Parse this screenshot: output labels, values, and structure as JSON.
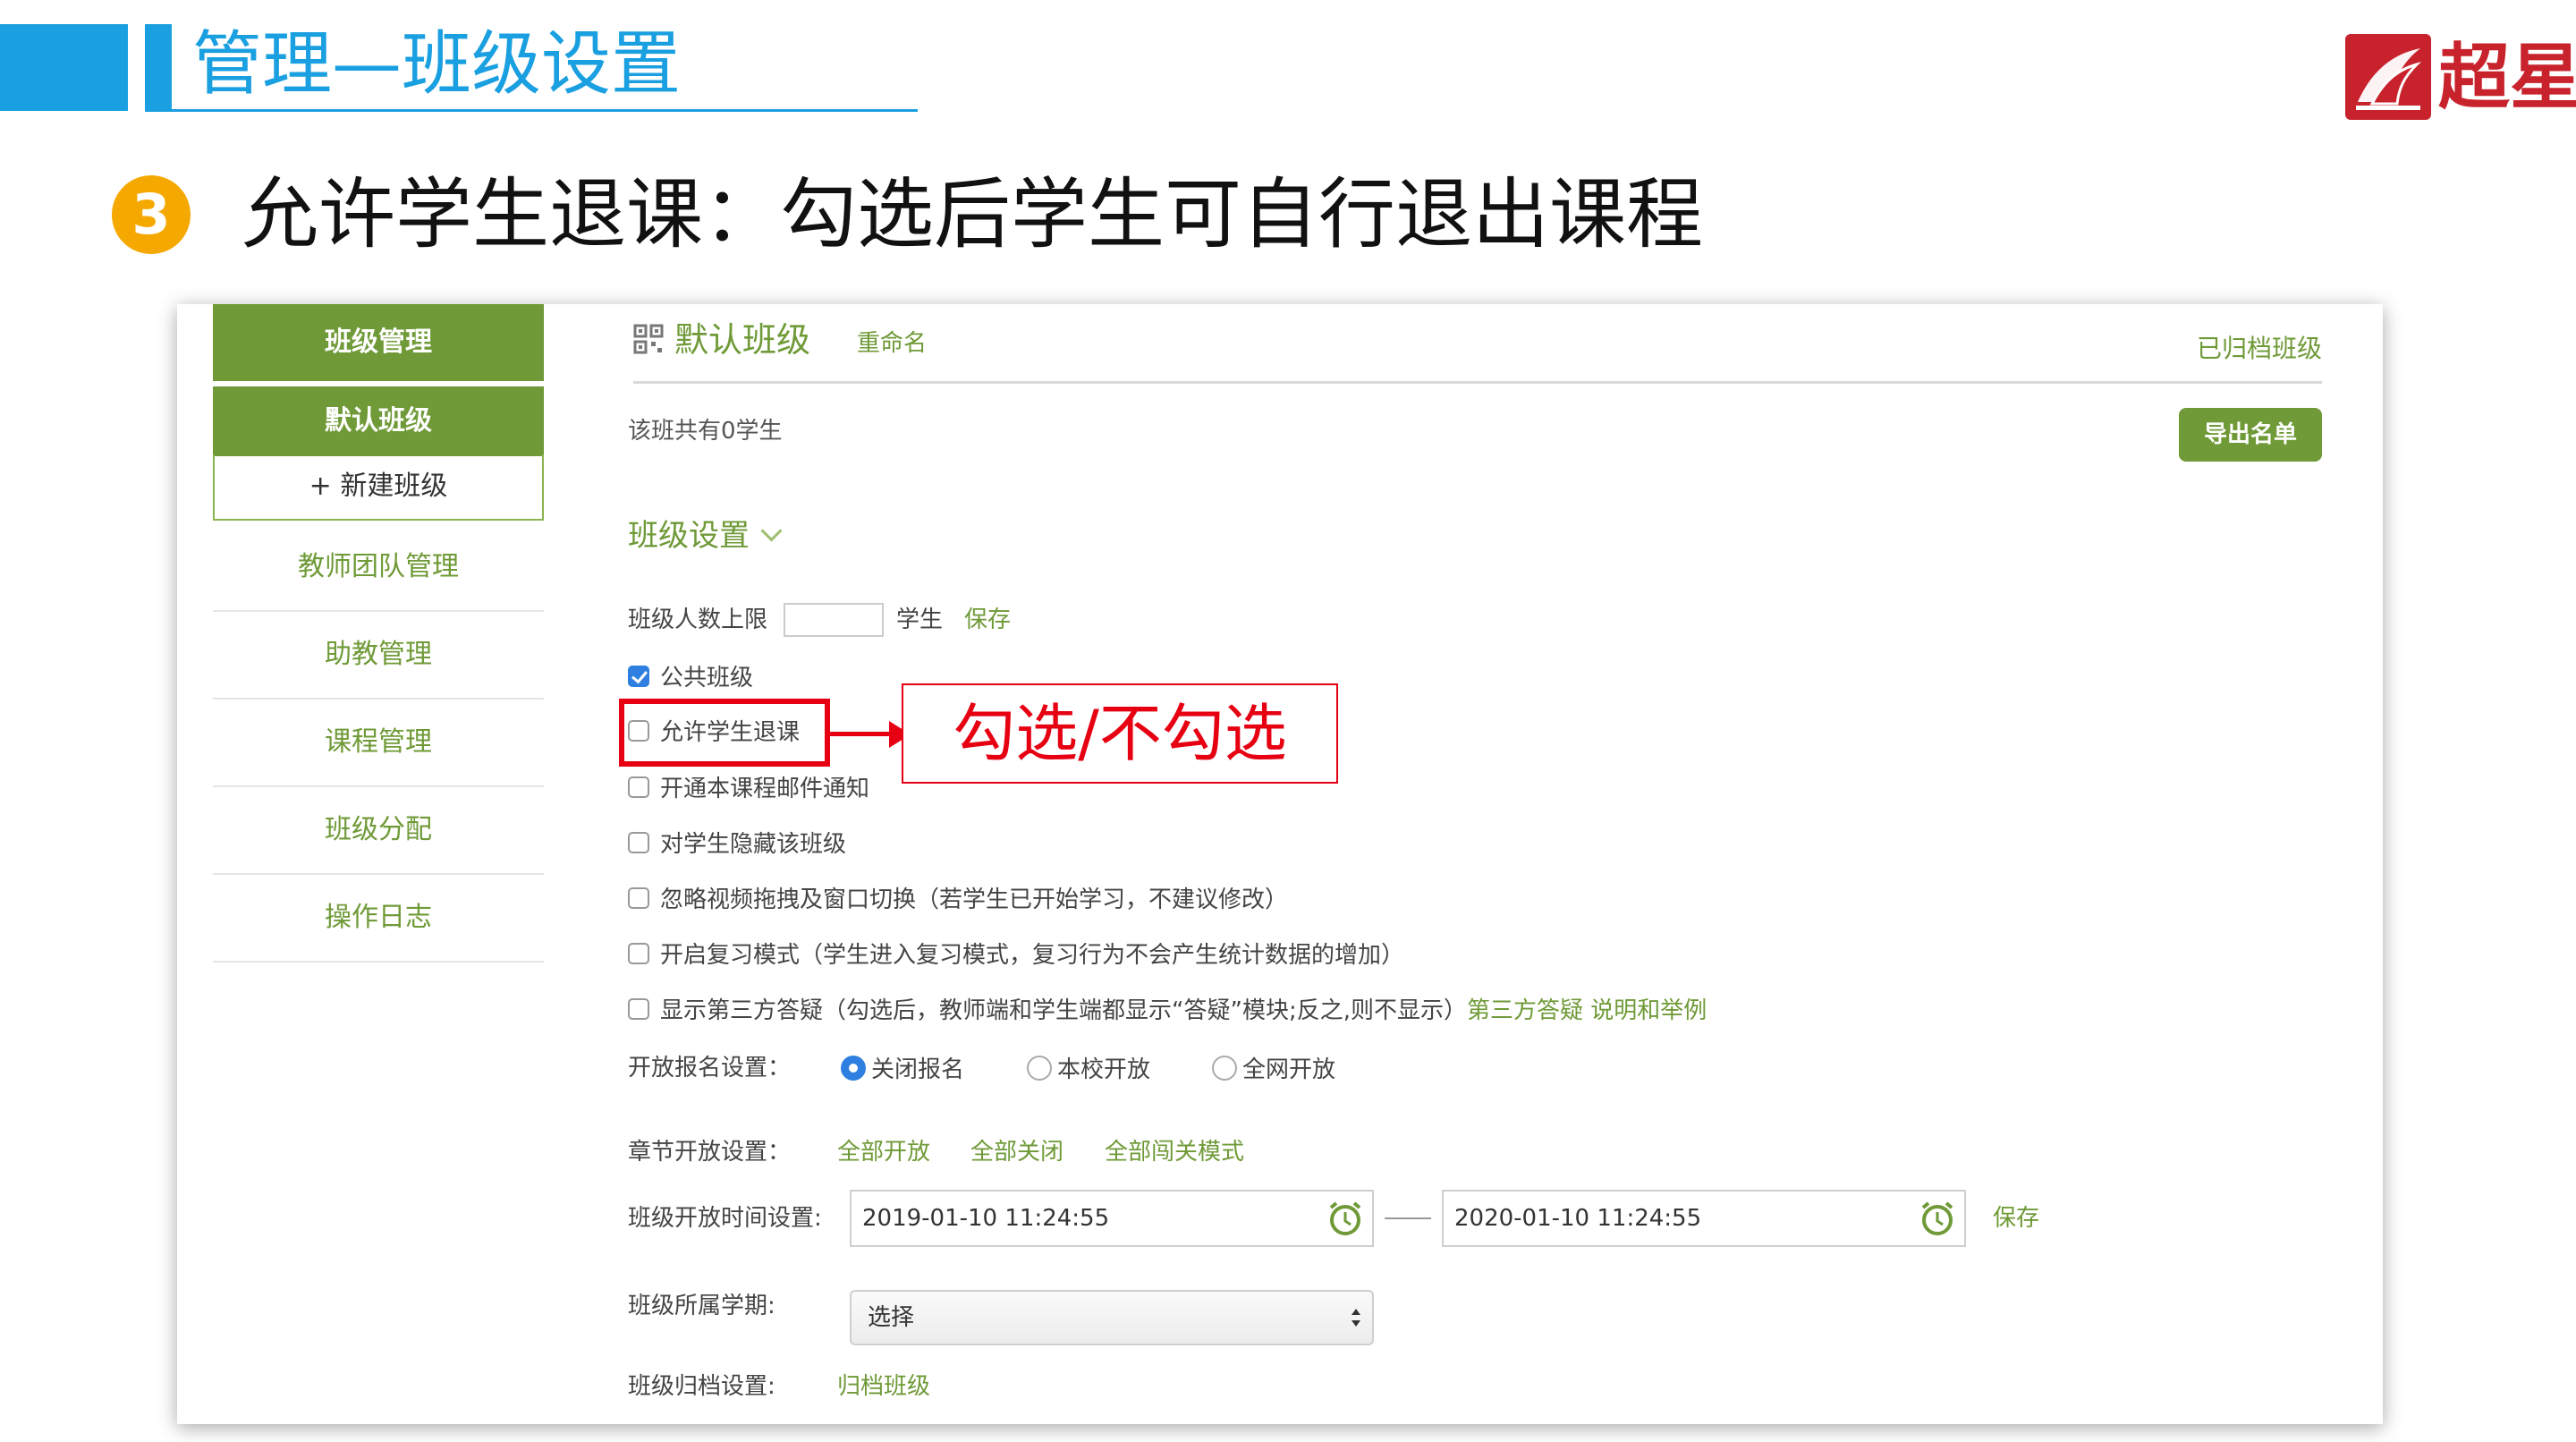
{
  "slide": {
    "header_title": "管理—班级设置",
    "logo_text": "超星",
    "step_number": "3",
    "step_title": "允许学生退课：勾选后学生可自行退出课程",
    "callout_text": "勾选/不勾选"
  },
  "sidebar": {
    "header": "班级管理",
    "active_class": "默认班级",
    "new_class": "+ 新建班级",
    "items": [
      {
        "label": "教师团队管理"
      },
      {
        "label": "助教管理"
      },
      {
        "label": "课程管理"
      },
      {
        "label": "班级分配"
      },
      {
        "label": "操作日志"
      }
    ]
  },
  "main": {
    "class_name": "默认班级",
    "rename_link": "重命名",
    "archived_link": "已归档班级",
    "student_count_text": "该班共有0学生",
    "export_button": "导出名单",
    "settings_title": "班级设置",
    "capacity": {
      "label": "班级人数上限",
      "value": "",
      "unit": "学生",
      "save": "保存"
    },
    "checkboxes": [
      {
        "label": "公共班级",
        "checked": true
      },
      {
        "label": "允许学生退课",
        "checked": false
      },
      {
        "label": "开通本课程邮件通知",
        "checked": false
      },
      {
        "label": "对学生隐藏该班级",
        "checked": false
      },
      {
        "label": "忽略视频拖拽及窗口切换（若学生已开始学习，不建议修改）",
        "checked": false
      },
      {
        "label": "开启复习模式（学生进入复习模式，复习行为不会产生统计数据的增加）",
        "checked": false
      },
      {
        "label": "显示第三方答疑（勾选后，教师端和学生端都显示“答疑”模块;反之,则不显示）",
        "checked": false,
        "extra_link": "第三方答疑 说明和举例"
      }
    ],
    "enroll": {
      "label": "开放报名设置：",
      "options": [
        "关闭报名",
        "本校开放",
        "全网开放"
      ],
      "selected": "关闭报名"
    },
    "chapter": {
      "label": "章节开放设置：",
      "links": [
        "全部开放",
        "全部关闭",
        "全部闯关模式"
      ]
    },
    "open_time": {
      "label": "班级开放时间设置:",
      "start": "2019-01-10 11:24:55",
      "end": "2020-01-10 11:24:55",
      "save": "保存"
    },
    "term": {
      "label": "班级所属学期:",
      "select_value": "选择"
    },
    "archive": {
      "label": "班级归档设置:",
      "link": "归档班级"
    }
  },
  "colors": {
    "accent_blue": "#1a9fe0",
    "green": "#6f9a37",
    "annotation_red": "#e60012",
    "step_badge": "#f5a800"
  }
}
